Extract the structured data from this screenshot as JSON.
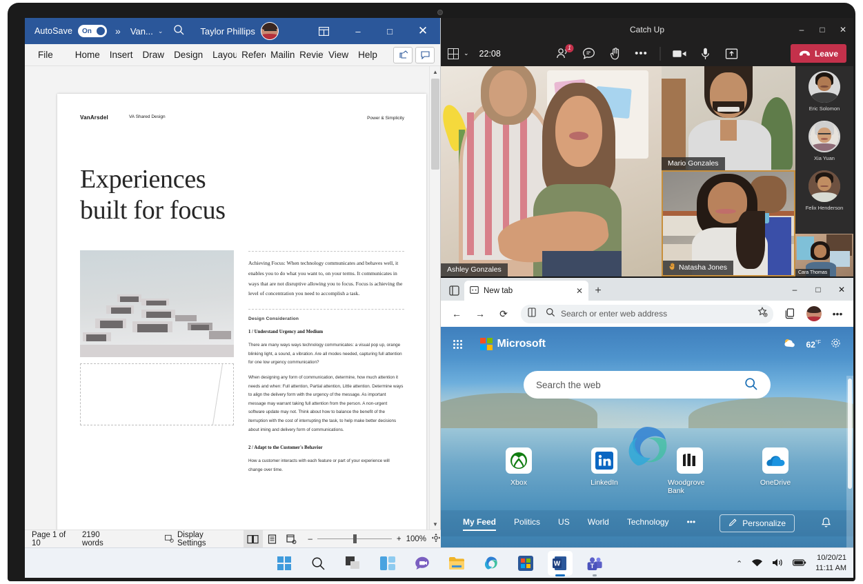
{
  "word": {
    "titlebar": {
      "autosave_label": "AutoSave",
      "autosave_state": "On",
      "more_chevron": "»",
      "doc_name": "Van...",
      "doc_chevron": "⌄",
      "search_icon": "search-icon",
      "user_name": "Taylor Phillips",
      "ribbon_display_icon": "ribbon-display-icon",
      "minimize": "–",
      "maximize": "□",
      "close": "✕"
    },
    "ribbon_tabs": [
      "File",
      "Home",
      "Insert",
      "Draw",
      "Design",
      "Layout",
      "References",
      "Mailings",
      "Review",
      "View",
      "Help"
    ],
    "ribbon_tabs_visible": [
      "File",
      "Home",
      "Insert",
      "Draw",
      "Design",
      "Layou",
      "Refere",
      "Mailing",
      "Review",
      "View",
      "Help"
    ],
    "ribbon_right": [
      "share-icon",
      "comment-icon"
    ],
    "document": {
      "brand": "VanArsdel",
      "brand_sub": "VA Shared Design",
      "brand_right": "Power & Simplicity",
      "title_line1": "Experiences",
      "title_line2": "built for focus",
      "intro_paragraph": "Achieving Focus: When technology communicates and behaves well, it enables you to do what you want to, on your terms. It communicates in ways that are not disruptive allowing you to focus. Focus is achieving the level of concentration you need to accomplish a task.",
      "section_label": "Design Consideration",
      "sub_head_1": "1 / Understand Urgency and Medium",
      "body_1": "There are many ways ways technology communicates: a visual pop up, orange blinking light, a sound, a vibration. Are all modes needed, capturing full attention for one low urgency communication?",
      "body_2": "When designing any form of communication, determine, how much attention it needs and when: Full attention, Partial attention, Little attention. Determine ways to align the delivery form with the urgency of the message. As important message may warrant taking full attention from the person. A non-urgent software update may not. Think about how to balance the benefit of the iterruption with the cost of interrupting the task, to help make better decisions about iming and delivery form of communications.",
      "sub_head_2": "2 / Adapt to the Customer's Behavior",
      "body_3": "How a customer interacts with each feature or part of your experience will change over time."
    },
    "status": {
      "page_info": "Page 1 of 10",
      "word_count": "2190 words",
      "display_settings": "Display Settings",
      "views": [
        "read-mode-icon",
        "print-layout-icon",
        "web-layout-icon"
      ],
      "zoom_out": "–",
      "zoom_in": "+",
      "zoom_level": "100%",
      "focus_icon": "focus-icon"
    }
  },
  "teams": {
    "title": "Catch Up",
    "window_controls": {
      "minimize": "–",
      "maximize": "□",
      "close": "✕"
    },
    "toolbar": {
      "layout_icon": "grid-layout-icon",
      "layout_chevron": "⌄",
      "duration": "22:08",
      "people_icon": "people-icon",
      "people_badge": "1",
      "chat_icon": "chat-icon",
      "raise_hand_icon": "raise-hand-icon",
      "more_icon": "•••",
      "camera_icon": "camera-icon",
      "mic_icon": "microphone-icon",
      "share_icon": "share-screen-icon",
      "leave_label": "Leave",
      "leave_color": "#c4314b"
    },
    "tiles": [
      {
        "name": "Ashley Gonzales",
        "hand_raised": false
      },
      {
        "name": "Mario Gonzales",
        "hand_raised": false
      },
      {
        "name": "Natasha Jones",
        "hand_raised": true,
        "speaking": true
      }
    ],
    "roster": [
      {
        "name": "Eric Solomon"
      },
      {
        "name": "Xia Yuan"
      },
      {
        "name": "Felix Henderson"
      },
      {
        "name": "Cara Thomas"
      }
    ]
  },
  "edge": {
    "tab_search_icon": "tab-search-icon",
    "tab": {
      "title": "New tab",
      "favicon": "newtab-icon",
      "close": "✕"
    },
    "new_tab_button": "+",
    "window_controls": {
      "minimize": "–",
      "maximize": "□",
      "close": "✕"
    },
    "toolbar": {
      "back": "←",
      "forward": "→",
      "refresh": "⟳",
      "split_icon": "split-screen-icon",
      "search_icon": "search-icon",
      "address_placeholder": "Search or enter web address",
      "favorite_icon": "add-favorite-icon",
      "collections_icon": "collections-icon",
      "profile_icon": "profile-avatar",
      "settings_more": "•••"
    },
    "newtab": {
      "waffle_icon": "app-launcher-icon",
      "logo_text": "Microsoft",
      "weather_icon": "partly-cloudy-icon",
      "weather_temp": "62",
      "weather_unit": "°F",
      "settings_icon": "gear-icon",
      "search_placeholder": "Search the web",
      "search_icon": "search-icon",
      "tiles": [
        {
          "label": "Xbox",
          "icon": "xbox-icon",
          "color": "#107c10"
        },
        {
          "label": "LinkedIn",
          "icon": "linkedin-icon",
          "color": "#0a66c2"
        },
        {
          "label": "Woodgrove Bank",
          "icon": "woodgrove-bank-icon",
          "color": "#1b1b1b"
        },
        {
          "label": "OneDrive",
          "icon": "onedrive-icon",
          "color": "#0364b8"
        }
      ],
      "feed_nav": [
        "My Feed",
        "Politics",
        "US",
        "World",
        "Technology"
      ],
      "feed_more": "•••",
      "personalize_label": "Personalize",
      "personalize_icon": "pencil-icon",
      "notifications_icon": "bell-icon"
    }
  },
  "taskbar": {
    "apps": [
      {
        "name": "start-button",
        "icon": "windows-logo-icon"
      },
      {
        "name": "search-button",
        "icon": "search-icon"
      },
      {
        "name": "task-view-button",
        "icon": "task-view-icon"
      },
      {
        "name": "widgets-button",
        "icon": "widgets-icon"
      },
      {
        "name": "chat-button",
        "icon": "chat-bubble-icon"
      },
      {
        "name": "file-explorer-button",
        "icon": "folder-icon"
      },
      {
        "name": "edge-button",
        "icon": "edge-icon"
      },
      {
        "name": "store-button",
        "icon": "microsoft-store-icon"
      },
      {
        "name": "word-button",
        "icon": "word-icon"
      },
      {
        "name": "teams-button",
        "icon": "teams-icon"
      }
    ],
    "tray": {
      "chevron": "⌃",
      "wifi_icon": "wifi-icon",
      "volume_icon": "volume-icon",
      "battery_icon": "battery-icon",
      "date": "10/20/21",
      "time": "11:11 AM"
    }
  }
}
